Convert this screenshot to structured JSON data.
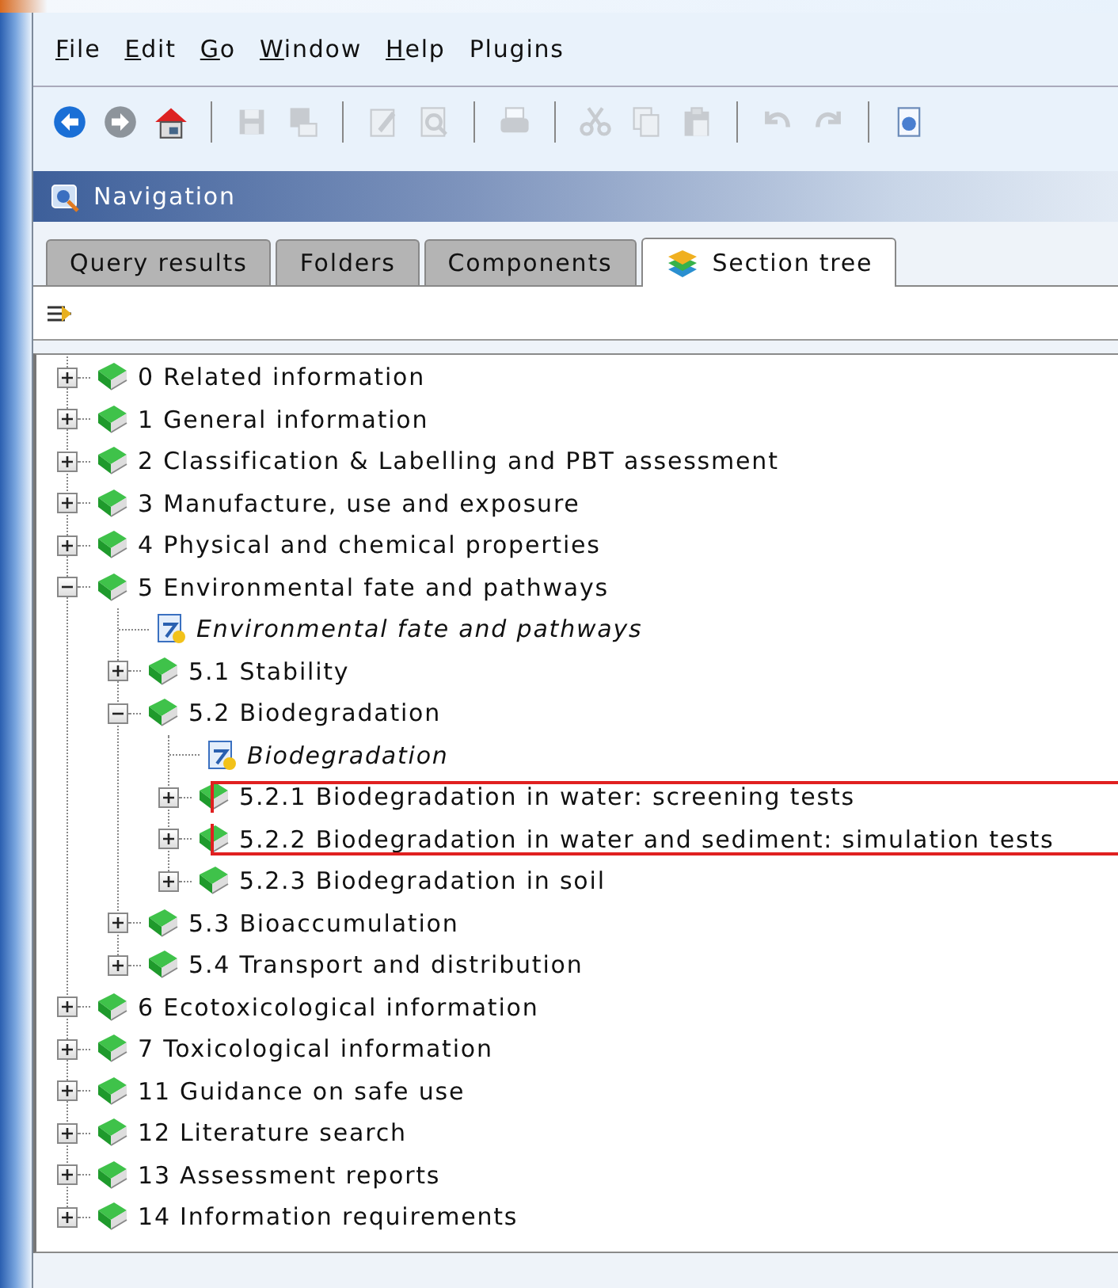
{
  "menu": [
    {
      "label": "File",
      "mnemonic": true
    },
    {
      "label": "Edit",
      "mnemonic": true
    },
    {
      "label": "Go",
      "mnemonic": true
    },
    {
      "label": "Window",
      "mnemonic": true
    },
    {
      "label": "Help",
      "mnemonic": true
    },
    {
      "label": "Plugins",
      "mnemonic": false
    }
  ],
  "toolbar": [
    {
      "kind": "back",
      "disabled": false
    },
    {
      "kind": "forward",
      "disabled": false
    },
    {
      "kind": "home",
      "disabled": false
    },
    {
      "kind": "separator"
    },
    {
      "kind": "save",
      "disabled": true
    },
    {
      "kind": "save-all",
      "disabled": true
    },
    {
      "kind": "separator"
    },
    {
      "kind": "edit",
      "disabled": true
    },
    {
      "kind": "preview",
      "disabled": true
    },
    {
      "kind": "separator"
    },
    {
      "kind": "print",
      "disabled": true
    },
    {
      "kind": "separator"
    },
    {
      "kind": "cut",
      "disabled": true
    },
    {
      "kind": "copy",
      "disabled": true
    },
    {
      "kind": "paste",
      "disabled": true
    },
    {
      "kind": "separator"
    },
    {
      "kind": "undo",
      "disabled": true
    },
    {
      "kind": "redo",
      "disabled": true
    },
    {
      "kind": "separator"
    },
    {
      "kind": "info",
      "disabled": false
    }
  ],
  "panel": {
    "title": "Navigation"
  },
  "tabs": [
    {
      "label": "Query results",
      "selected": false,
      "has_icon": false
    },
    {
      "label": "Folders",
      "selected": false,
      "has_icon": false
    },
    {
      "label": "Components",
      "selected": false,
      "has_icon": false
    },
    {
      "label": "Section tree",
      "selected": true,
      "has_icon": true
    }
  ],
  "tree": [
    {
      "label": "0 Related information",
      "kind": "section",
      "expanded": false
    },
    {
      "label": "1 General information",
      "kind": "section",
      "expanded": false
    },
    {
      "label": "2 Classification & Labelling and PBT assessment",
      "kind": "section",
      "expanded": false
    },
    {
      "label": "3 Manufacture, use and exposure",
      "kind": "section",
      "expanded": false
    },
    {
      "label": "4 Physical and chemical properties",
      "kind": "section",
      "expanded": false
    },
    {
      "label": "5 Environmental fate and pathways",
      "kind": "section",
      "expanded": true,
      "children": [
        {
          "label": "Environmental fate and pathways",
          "kind": "document"
        },
        {
          "label": "5.1 Stability",
          "kind": "section",
          "expanded": false
        },
        {
          "label": "5.2 Biodegradation",
          "kind": "section",
          "expanded": true,
          "children": [
            {
              "label": "Biodegradation",
              "kind": "document"
            },
            {
              "label": "5.2.1 Biodegradation in water: screening tests",
              "kind": "section",
              "expanded": false,
              "highlighted": true
            },
            {
              "label": "5.2.2 Biodegradation in water and sediment: simulation tests",
              "kind": "section",
              "expanded": false,
              "highlighted": true
            },
            {
              "label": "5.2.3 Biodegradation in soil",
              "kind": "section",
              "expanded": false
            }
          ]
        },
        {
          "label": "5.3 Bioaccumulation",
          "kind": "section",
          "expanded": false
        },
        {
          "label": "5.4 Transport and distribution",
          "kind": "section",
          "expanded": false
        }
      ]
    },
    {
      "label": "6 Ecotoxicological information",
      "kind": "section",
      "expanded": false
    },
    {
      "label": "7 Toxicological information",
      "kind": "section",
      "expanded": false
    },
    {
      "label": "11 Guidance on safe use",
      "kind": "section",
      "expanded": false
    },
    {
      "label": "12 Literature search",
      "kind": "section",
      "expanded": false
    },
    {
      "label": "13 Assessment reports",
      "kind": "section",
      "expanded": false
    },
    {
      "label": "14 Information requirements",
      "kind": "section",
      "expanded": false
    }
  ]
}
